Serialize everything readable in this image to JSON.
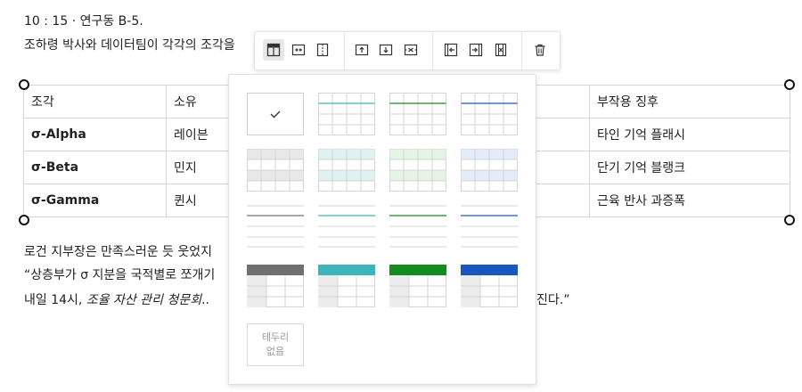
{
  "doc": {
    "line1": "10 : 15 · 연구동 B-5.",
    "line2": "조하령 박사와 데이터팀이 각각의 조각을",
    "para1": "로건 지부장은 만족스러운 듯 웃었지",
    "para2": "“상층부가 σ 지분을 국적별로 쪼개기",
    "para3_prefix": "내일 14시, ",
    "para3_italic": "조율 자산 관리 청문회",
    "para3_dots": "..",
    "para3_suffix": "진다.”"
  },
  "table": {
    "headers": [
      "조각",
      "소유",
      "부작용 징후"
    ],
    "rows": [
      {
        "piece": "σ-Alpha",
        "owner": "레이븐",
        "effect": "타인 기억 플래시"
      },
      {
        "piece": "σ-Beta",
        "owner": "민지",
        "effect": "단기 기억 블랭크"
      },
      {
        "piece": "σ-Gamma",
        "owner": "퀸시",
        "effect": "근육 반사 과증폭"
      }
    ]
  },
  "toolbar": {
    "icons": [
      "table-style-icon",
      "merge-cells-icon",
      "split-cells-icon",
      "insert-row-above-icon",
      "insert-row-below-icon",
      "delete-row-icon",
      "insert-column-left-icon",
      "insert-column-right-icon",
      "delete-column-icon",
      "delete-table-icon"
    ]
  },
  "style_panel": {
    "no_border_line1": "테두리",
    "no_border_line2": "없음",
    "colors": {
      "mint": "#3cb6b8",
      "green": "#158a1e",
      "blue": "#1a56c0",
      "gray": "#707070",
      "check": "#333333"
    }
  }
}
